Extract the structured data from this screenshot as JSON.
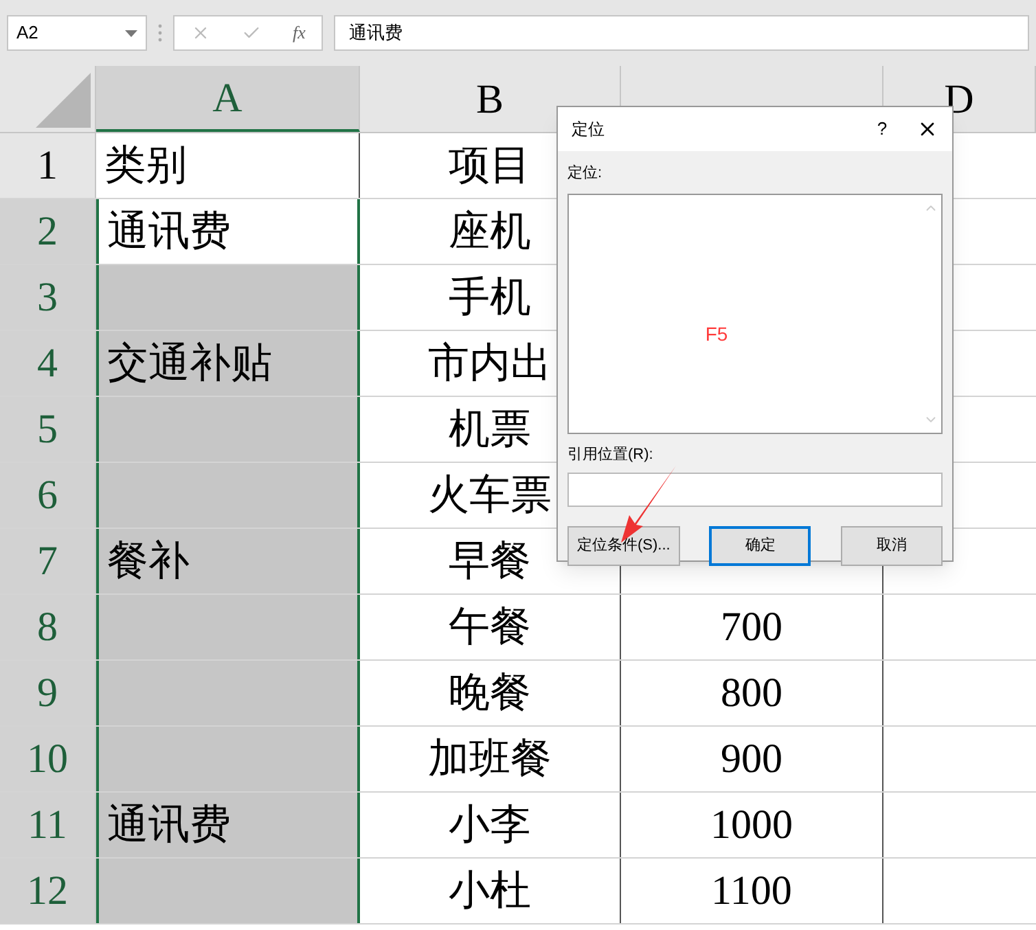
{
  "formula_bar": {
    "name_box": "A2",
    "function_label": "fx",
    "value": "通讯费"
  },
  "columns": [
    {
      "label": "A",
      "selected": true
    },
    {
      "label": "B",
      "selected": false
    },
    {
      "selected": false
    },
    {
      "label": "D",
      "selected": false
    }
  ],
  "rows": [
    {
      "number": "1",
      "selected": false,
      "cells": [
        "类别",
        "项目",
        ""
      ]
    },
    {
      "number": "2",
      "selected": true,
      "active": true,
      "cells": [
        "通讯费",
        "座机",
        ""
      ]
    },
    {
      "number": "3",
      "selected": true,
      "cells": [
        "",
        "手机",
        ""
      ]
    },
    {
      "number": "4",
      "selected": true,
      "cells": [
        "交通补贴",
        "市内出",
        ""
      ]
    },
    {
      "number": "5",
      "selected": true,
      "cells": [
        "",
        "机票",
        ""
      ]
    },
    {
      "number": "6",
      "selected": true,
      "cells": [
        "",
        "火车票",
        ""
      ]
    },
    {
      "number": "7",
      "selected": true,
      "cells": [
        "餐补",
        "早餐",
        ""
      ]
    },
    {
      "number": "8",
      "selected": true,
      "cells": [
        "",
        "午餐",
        "700"
      ]
    },
    {
      "number": "9",
      "selected": true,
      "cells": [
        "",
        "晚餐",
        "800"
      ]
    },
    {
      "number": "10",
      "selected": true,
      "cells": [
        "",
        "加班餐",
        "900"
      ]
    },
    {
      "number": "11",
      "selected": true,
      "cells": [
        "通讯费",
        "小李",
        "1000"
      ]
    },
    {
      "number": "12",
      "selected": true,
      "cells": [
        "",
        "小杜",
        "1100"
      ]
    }
  ],
  "dialog": {
    "title": "定位",
    "help": "?",
    "list_label": "定位:",
    "list_note": "F5",
    "reference_label": "引用位置(R):",
    "buttons": [
      {
        "label": "定位条件(S)...",
        "selected": false
      },
      {
        "label": "确定",
        "selected": true
      },
      {
        "label": "取消",
        "selected": false
      }
    ]
  }
}
